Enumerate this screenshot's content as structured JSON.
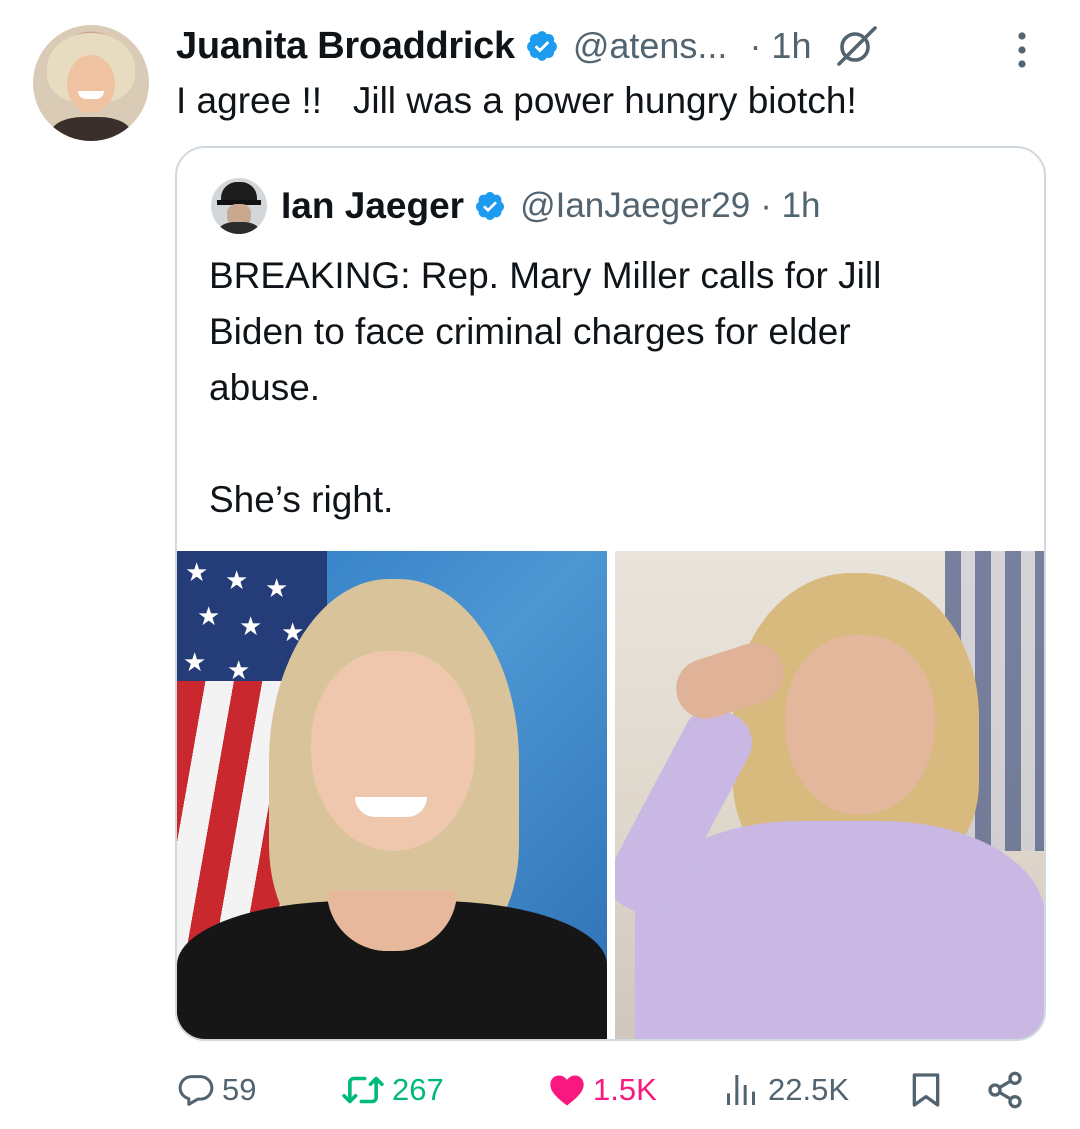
{
  "tweet": {
    "author_name": "Juanita Broaddrick",
    "author_handle": "@atens...",
    "time": "· 1h",
    "text": "I agree !!   Jill was a power hungry biotch!"
  },
  "quoted_tweet": {
    "author_name": "Ian Jaeger",
    "author_handle": "@IanJaeger29",
    "time": "· 1h",
    "text_lines": [
      "BREAKING: Rep. Mary Miller calls for Jill",
      "Biden to face criminal charges for elder",
      "abuse."
    ],
    "text_after": "She’s right.",
    "images": [
      "portrait-woman-flag-background",
      "portrait-woman-lilac-jacket"
    ]
  },
  "actions": {
    "replies": "59",
    "retweets": "267",
    "likes": "1.5K",
    "views": "22.5K"
  },
  "colors": {
    "verified": "#1d9bf0",
    "retweet": "#00ba7c",
    "like": "#f91880",
    "secondary_text": "#536471",
    "border": "#cfd9de"
  },
  "icons": {
    "verified": "verified-badge-icon",
    "grok": "grok-icon",
    "more": "more-icon",
    "reply": "reply-icon",
    "retweet": "retweet-icon",
    "like": "heart-icon",
    "views": "views-icon",
    "bookmark": "bookmark-icon",
    "share": "share-icon"
  }
}
